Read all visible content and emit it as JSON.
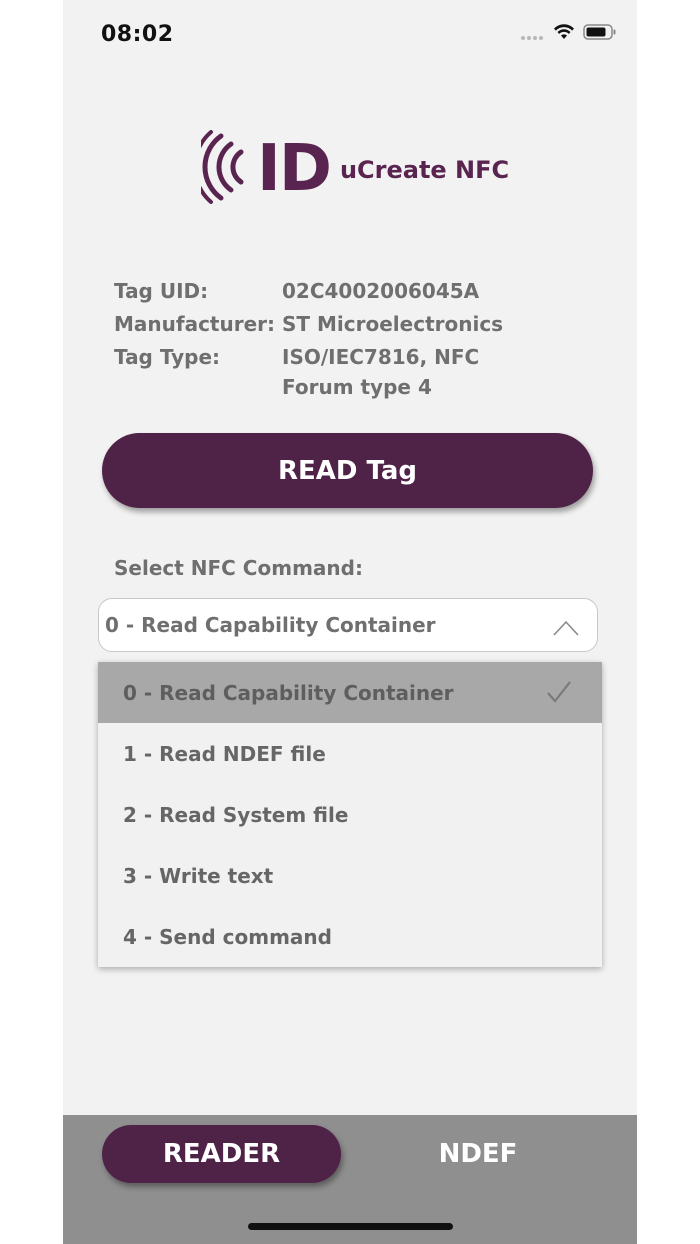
{
  "status_bar": {
    "time": "08:02",
    "icons": [
      "signal-dots-icon",
      "wifi-icon",
      "battery-icon"
    ]
  },
  "logo": {
    "mark": "ID",
    "text": "uCreate NFC",
    "color": "#5a2451"
  },
  "tag_info": {
    "rows": [
      {
        "label": "Tag UID:",
        "value": "02C4002006045A"
      },
      {
        "label": "Manufacturer:",
        "value": "ST Microelectronics"
      },
      {
        "label": "Tag Type:",
        "value": "ISO/IEC7816, NFC Forum type 4"
      }
    ]
  },
  "read_button": {
    "label": "READ Tag",
    "color": "#4f2248"
  },
  "command_select": {
    "label": "Select NFC Command:",
    "selected": "0 - Read Capability Container",
    "options": [
      "0 - Read Capability Container",
      "1 - Read NDEF file",
      "2 - Read System file",
      "3 - Write text",
      "4 - Send command"
    ]
  },
  "bottom_tabs": {
    "reader": "READER",
    "ndef": "NDEF",
    "active": "READER"
  }
}
